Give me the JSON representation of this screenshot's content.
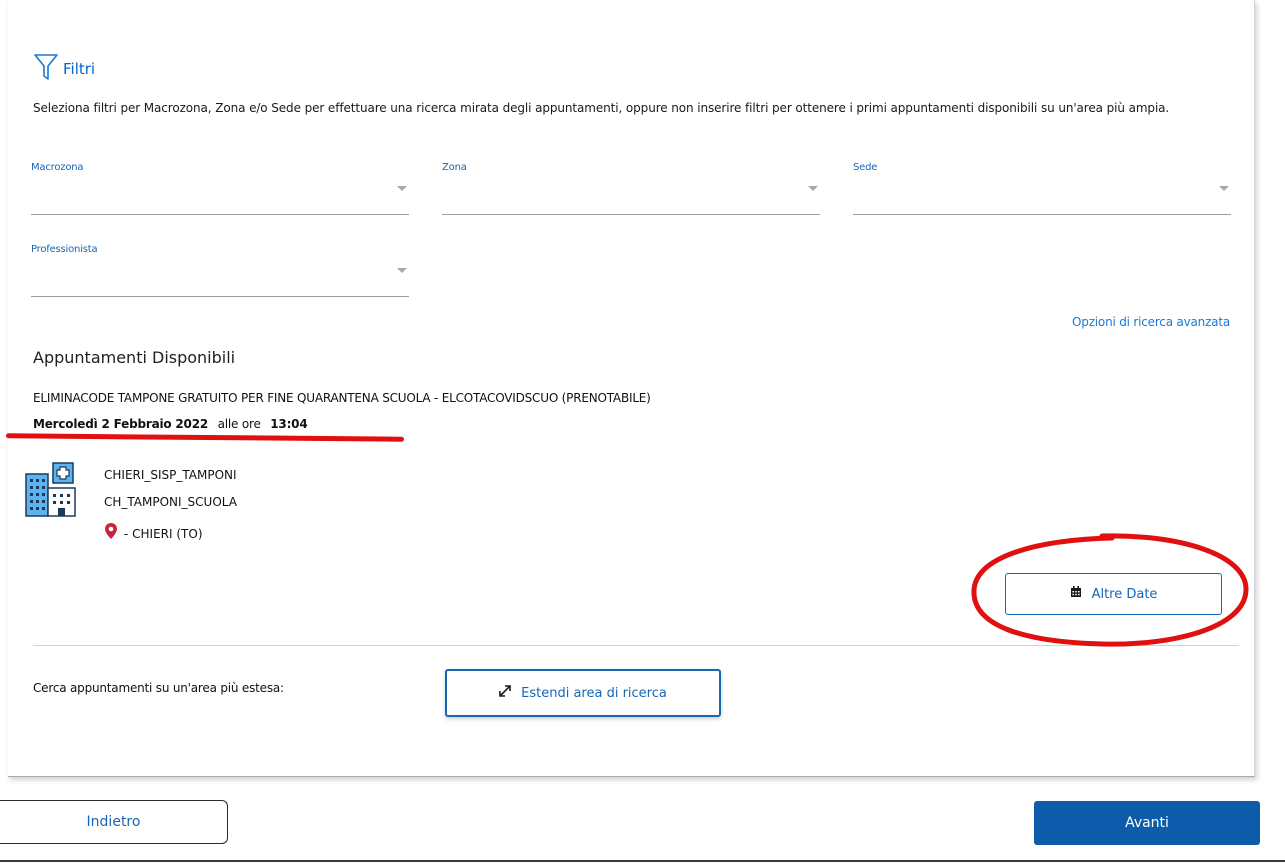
{
  "filters": {
    "title": "Filtri",
    "description": "Seleziona filtri per Macrozona, Zona e/o Sede per effettuare una ricerca mirata degli appuntamenti, oppure non inserire filtri per ottenere i primi appuntamenti disponibili su un'area più ampia.",
    "macrozona_label": "Macrozona",
    "zona_label": "Zona",
    "sede_label": "Sede",
    "professionista_label": "Professionista",
    "advanced_link": "Opzioni di ricerca avanzata"
  },
  "appointments": {
    "section_title": "Appuntamenti Disponibili",
    "service_name": "ELIMINACODE TAMPONE GRATUITO PER FINE QUARANTENA SCUOLA - ELCOTACOVIDSCUO (PRENOTABILE)",
    "date": "Mercoledì 2 Febbraio 2022",
    "time_prefix": "alle ore",
    "time": "13:04",
    "location_line1": "CHIERI_SISP_TAMPONI",
    "location_line2": "CH_TAMPONI_SCUOLA",
    "location_city": "- CHIERI (TO)",
    "other_dates_button": "Altre Date"
  },
  "extend": {
    "label": "Cerca appuntamenti su un'area più estesa:",
    "button": "Estendi area di ricerca"
  },
  "nav": {
    "back": "Indietro",
    "next": "Avanti"
  },
  "colors": {
    "accent": "#1766b5",
    "primary_button": "#0d5cab",
    "annotation": "#e01010",
    "pin": "#c4263a"
  }
}
